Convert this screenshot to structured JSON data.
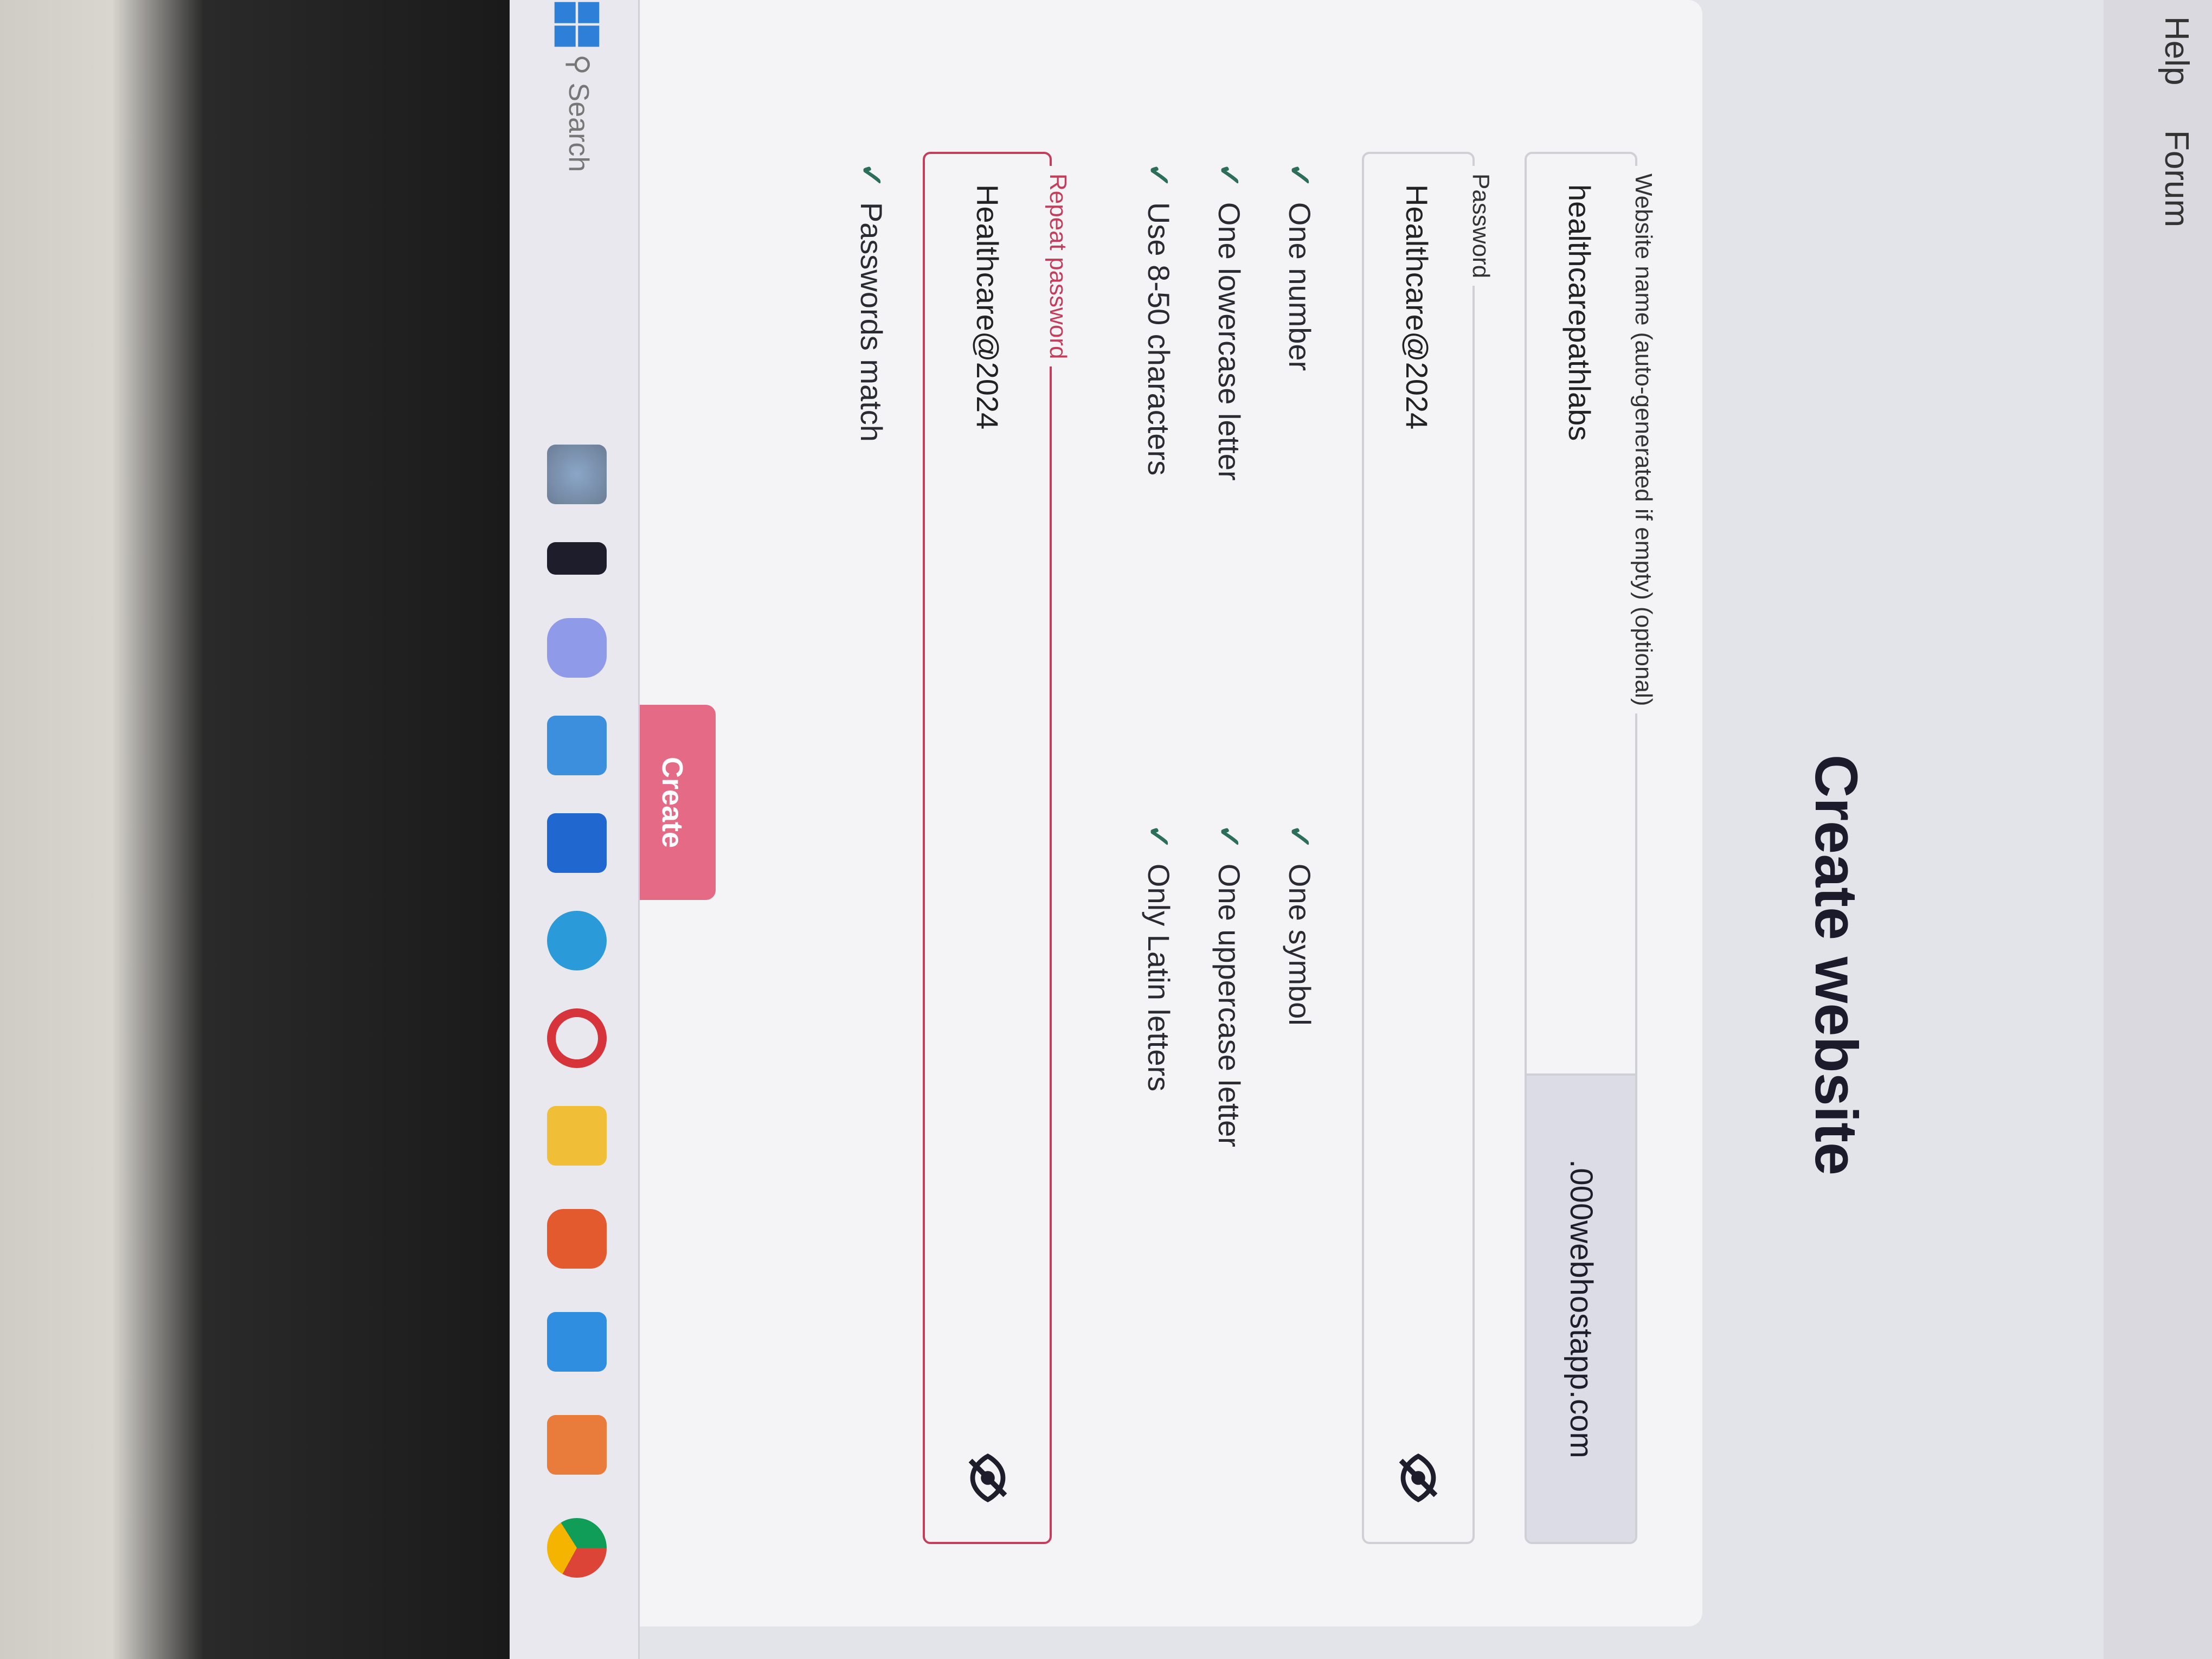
{
  "nav": {
    "help": "Help",
    "forum": "Forum"
  },
  "page_title": "Create website",
  "form": {
    "website_name": {
      "label": "Website name (auto-generated if empty) (optional)",
      "value": "healthcarepathlabs",
      "suffix": ".000webhostapp.com"
    },
    "password": {
      "label": "Password",
      "value": "Healthcare@2024",
      "toggle_icon": "eye-off-icon"
    },
    "requirements": [
      {
        "text": "One number",
        "met": true
      },
      {
        "text": "One symbol",
        "met": true
      },
      {
        "text": "One lowercase letter",
        "met": true
      },
      {
        "text": "One uppercase letter",
        "met": true
      },
      {
        "text": "Use 8-50 characters",
        "met": true
      },
      {
        "text": "Only Latin letters",
        "met": true
      }
    ],
    "repeat_password": {
      "label": "Repeat password",
      "value": "Healthcare@2024",
      "toggle_icon": "eye-off-icon"
    },
    "match_text": "Passwords match",
    "check_mark": "✓",
    "submit_label": "Create"
  },
  "taskbar": {
    "search_placeholder": "Search",
    "icons": [
      "windows-start-icon",
      "search-icon",
      "widgets-icon",
      "task-view-icon",
      "copilot-icon",
      "store-icon",
      "l-app-icon",
      "edge-icon",
      "opera-icon",
      "file-explorer-icon",
      "brave-icon",
      "vscode-icon",
      "xampp-icon",
      "chrome-icon"
    ]
  },
  "colors": {
    "accent": "#e46a86",
    "error_border": "#c43d5b",
    "check": "#2c6e59"
  }
}
